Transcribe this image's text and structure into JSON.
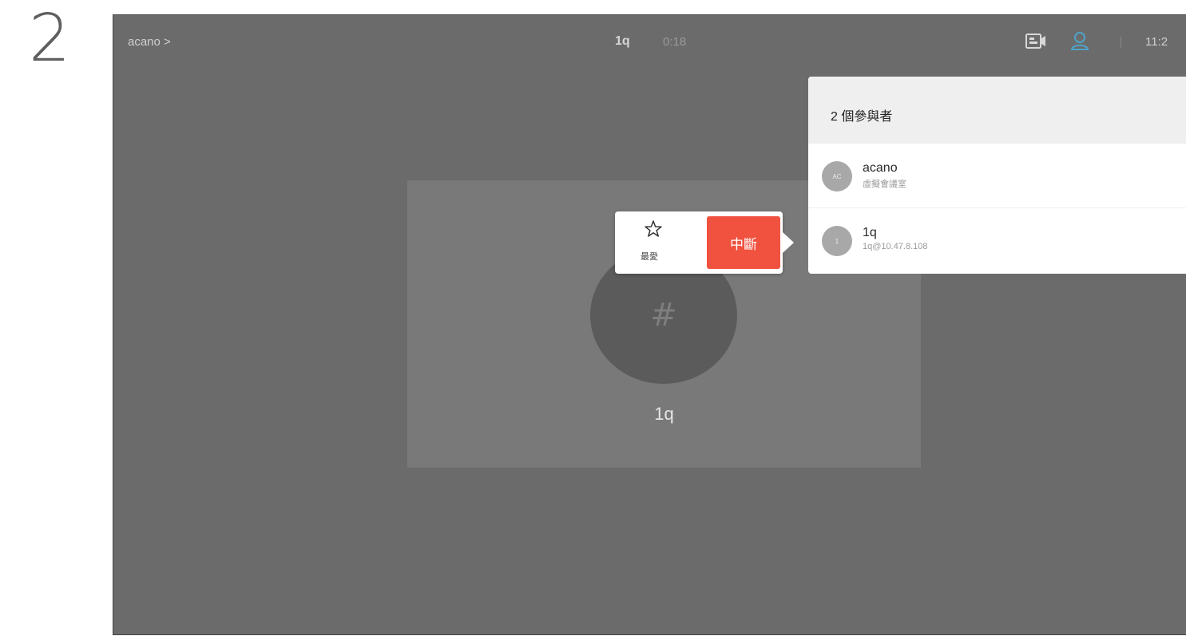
{
  "step": "2",
  "topbar": {
    "breadcrumb": "acano >",
    "call_name": "1q",
    "call_timer": "0:18",
    "clock": "11:2"
  },
  "tile": {
    "avatar_glyph": "#",
    "name": "1q"
  },
  "popup": {
    "favorite_label": "最愛",
    "drop_label": "中斷"
  },
  "participants": {
    "title": "2 個參與者",
    "items": [
      {
        "initials": "AC",
        "name": "acano",
        "detail": "虛擬會議室"
      },
      {
        "initials": "1",
        "name": "1q",
        "detail": "1q@10.47.8.108"
      }
    ]
  },
  "colors": {
    "screen_bg": "#6b6b6b",
    "tile_bg": "#797979",
    "drop_button": "#f0523f",
    "person_icon": "#4fa3c7"
  },
  "icons": [
    "screen-share-icon",
    "person-icon",
    "star-icon"
  ]
}
